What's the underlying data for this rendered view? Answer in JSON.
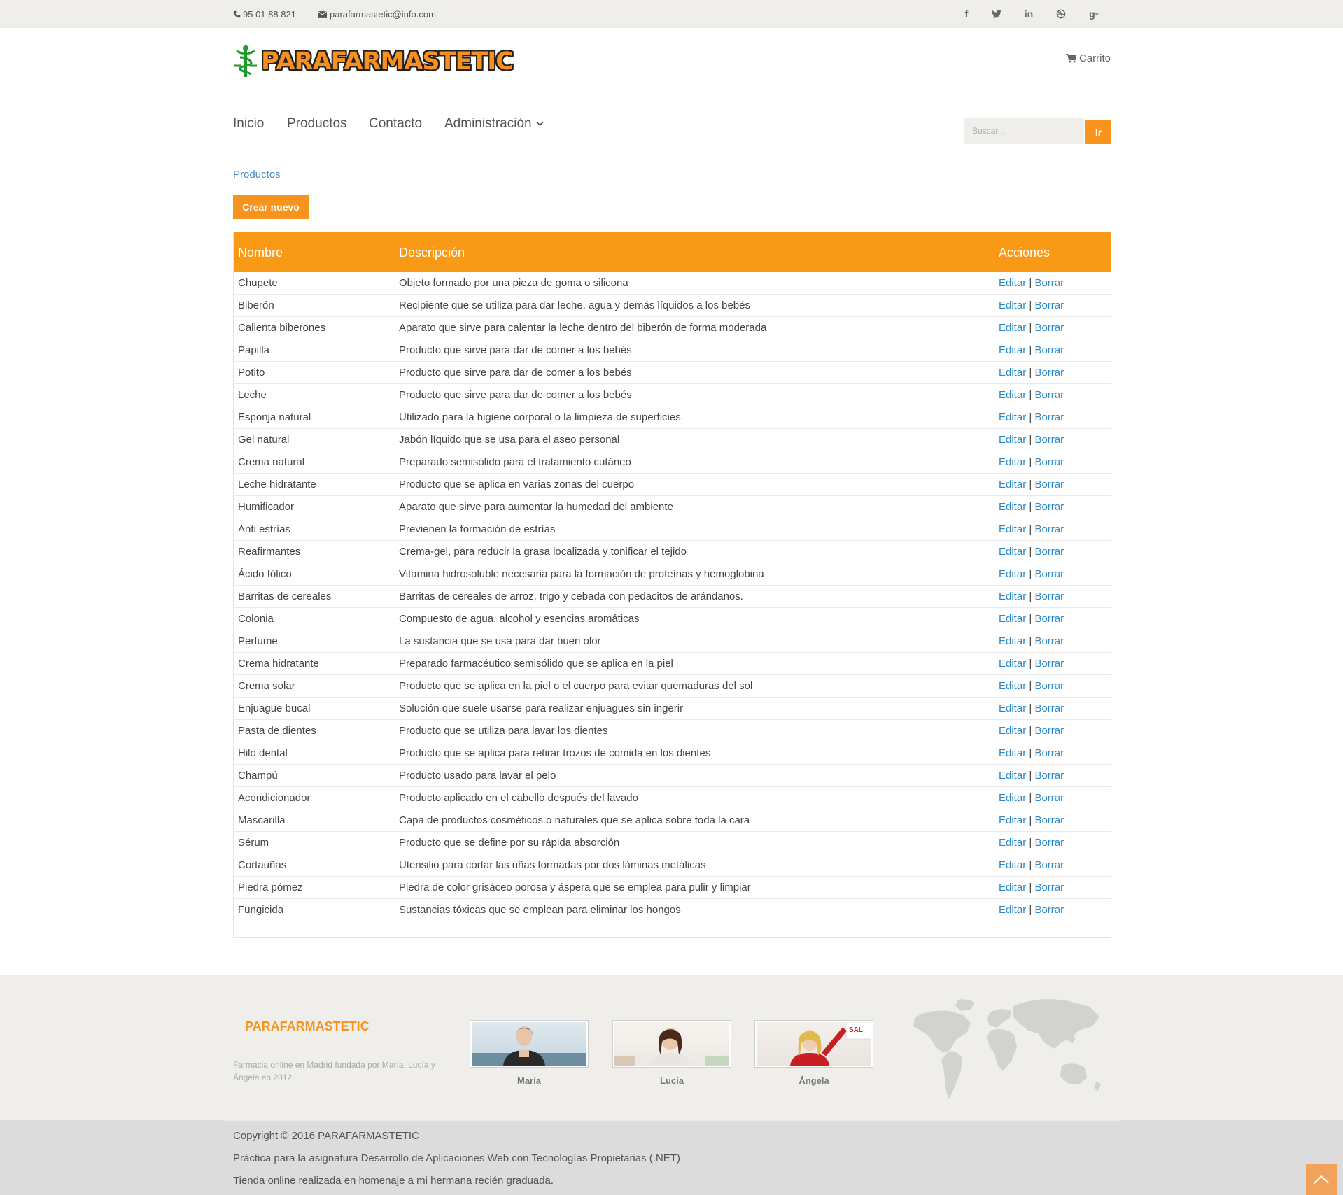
{
  "topbar": {
    "phone": "95 01 88 821",
    "email": "parafarmastetic@info.com",
    "social": [
      "facebook-icon",
      "twitter-icon",
      "linkedin-icon",
      "dribbble-icon",
      "google-plus-icon"
    ]
  },
  "header": {
    "logo_text": "PARAFARMASTETIC",
    "cart_label": "Carrito"
  },
  "nav": {
    "items": [
      "Inicio",
      "Productos",
      "Contacto",
      "Administración"
    ]
  },
  "search": {
    "placeholder": "Buscar...",
    "button_label": "Ir"
  },
  "page": {
    "breadcrumb": "Productos",
    "create_button": "Crear nuevo"
  },
  "table": {
    "columns": [
      "Nombre",
      "Descripción",
      "Acciones"
    ],
    "edit_label": "Editar",
    "delete_label": "Borrar",
    "separator": "|",
    "rows": [
      {
        "name": "Chupete",
        "desc": "Objeto formado por una pieza de goma o silicona"
      },
      {
        "name": "Biberón",
        "desc": "Recipiente que se utiliza para dar leche, agua y demás líquidos a los bebés"
      },
      {
        "name": "Calienta biberones",
        "desc": "Aparato que sirve para calentar la leche dentro del biberón de forma moderada"
      },
      {
        "name": "Papilla",
        "desc": "Producto que sirve para dar de comer a los bebés"
      },
      {
        "name": "Potito",
        "desc": "Producto que sirve para dar de comer a los bebés"
      },
      {
        "name": "Leche",
        "desc": "Producto que sirve para dar de comer a los bebés"
      },
      {
        "name": "Esponja natural",
        "desc": "Utilizado para la higiene corporal o la limpieza de superficies"
      },
      {
        "name": "Gel natural",
        "desc": "Jabón líquido que se usa para el aseo personal"
      },
      {
        "name": "Crema natural",
        "desc": "Preparado semisólido para el tratamiento cutáneo"
      },
      {
        "name": "Leche hidratante",
        "desc": "Producto que se aplica en varias zonas del cuerpo"
      },
      {
        "name": "Humificador",
        "desc": "Aparato que sirve para aumentar la humedad del ambiente"
      },
      {
        "name": "Anti estrías",
        "desc": "Previenen la formación de estrías"
      },
      {
        "name": "Reafirmantes",
        "desc": "Crema-gel, para reducir la grasa localizada y tonificar el tejido"
      },
      {
        "name": "Ácido fólico",
        "desc": "Vitamina hidrosoluble necesaria para la formación de proteínas y hemoglobina"
      },
      {
        "name": "Barritas de cereales",
        "desc": "Barritas de cereales de arroz, trigo y cebada con pedacitos de arándanos."
      },
      {
        "name": "Colonia",
        "desc": "Compuesto de agua, alcohol y esencias aromáticas"
      },
      {
        "name": "Perfume",
        "desc": "La sustancia que se usa para dar buen olor"
      },
      {
        "name": "Crema hidratante",
        "desc": "Preparado farmacéutico semisólido que se aplica en la piel"
      },
      {
        "name": "Crema solar",
        "desc": "Producto que se aplica en la piel o el cuerpo para evitar quemaduras del sol"
      },
      {
        "name": "Enjuague bucal",
        "desc": "Solución que suele usarse para realizar enjuagues sin ingerir"
      },
      {
        "name": "Pasta de dientes",
        "desc": "Producto que se utiliza para lavar los dientes"
      },
      {
        "name": "Hilo dental",
        "desc": "Producto que se aplica para retirar trozos de comida en los dientes"
      },
      {
        "name": "Champú",
        "desc": "Producto usado para lavar el pelo"
      },
      {
        "name": "Acondicionador",
        "desc": "Producto aplicado en el cabello después del lavado"
      },
      {
        "name": "Mascarilla",
        "desc": "Capa de productos cosméticos o naturales que se aplica sobre toda la cara"
      },
      {
        "name": "Sérum",
        "desc": "Producto que se define por su rápida absorción"
      },
      {
        "name": "Cortauñas",
        "desc": "Utensilio para cortar las uñas formadas por dos láminas metálicas"
      },
      {
        "name": "Piedra pómez",
        "desc": "Piedra de color grisáceo porosa y áspera que se emplea para pulir y limpiar"
      },
      {
        "name": "Fungicida",
        "desc": "Sustancias tóxicas que se emplean para eliminar los hongos"
      }
    ]
  },
  "footer": {
    "brand": "PARAFARMASTETIC",
    "about": "Farmacia online en Madrid fundada por María, Lucía y Ángela en 2012.",
    "team": [
      "María",
      "Lucía",
      "Ángela"
    ]
  },
  "copyright": {
    "line1": "Copyright © 2016 PARAFARMASTETIC",
    "line2": "Práctica para la asignatura Desarrollo de Aplicaciones Web con Tecnologías Propietarias (.NET)",
    "line3": "Tienda online realizada en homenaje a mi hermana recién graduada."
  },
  "colors": {
    "accent": "#f7941d",
    "table_header": "#f99a17",
    "link": "#2a88c8",
    "topbar_bg": "#efeeea",
    "footer_bg": "#efeeea",
    "copyright_bg": "#dcdcdc"
  }
}
